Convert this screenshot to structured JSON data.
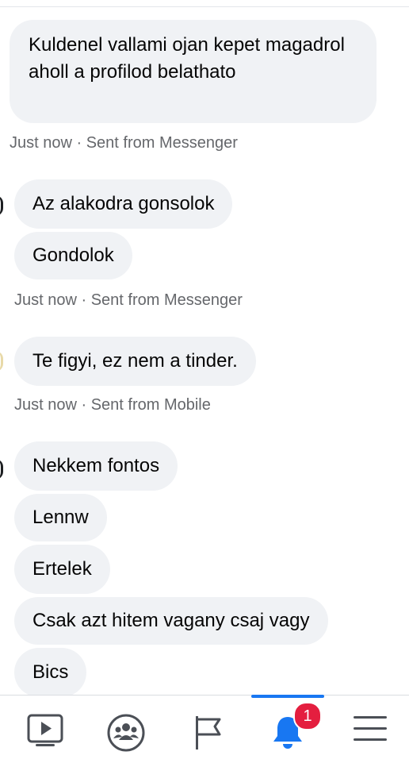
{
  "messages": [
    {
      "text": "Kuldenel vallami ojan kepet magadrol aholl a profilod belathato"
    },
    {
      "meta": "Just now · Sent from Messenger"
    },
    {
      "text": "Az alakodra gonsolok"
    },
    {
      "text": "Gondolok"
    },
    {
      "meta": "Just now · Sent from Messenger"
    },
    {
      "text": "Te figyi, ez nem a tinder."
    },
    {
      "meta": "Just now · Sent from Mobile"
    },
    {
      "text": "Nekkem fontos"
    },
    {
      "text": "Lennw"
    },
    {
      "text": "Ertelek"
    },
    {
      "text": "Csak azt hitem vagany csaj vagy"
    },
    {
      "text": "Bics"
    }
  ],
  "nav": {
    "items": [
      {
        "icon": "video-icon",
        "active": false
      },
      {
        "icon": "groups-icon",
        "active": false
      },
      {
        "icon": "pages-flag-icon",
        "active": false
      },
      {
        "icon": "notifications-bell-icon",
        "active": true,
        "badge": "1"
      },
      {
        "icon": "menu-icon",
        "active": false
      }
    ],
    "accent_color": "#1877f2",
    "badge_color": "#e41e3f"
  }
}
